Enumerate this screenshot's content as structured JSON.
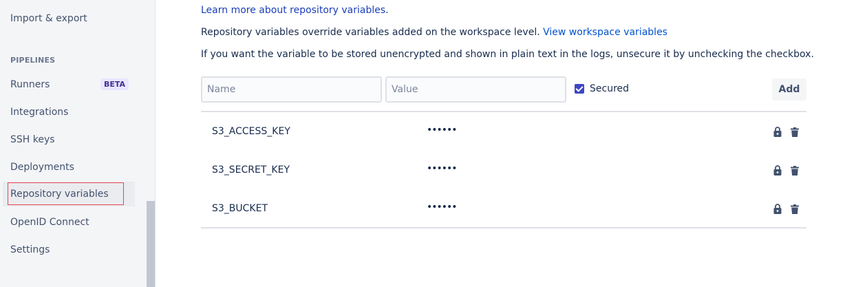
{
  "sidebar": {
    "top_item": "Import & export",
    "section_title": "PIPELINES",
    "items": [
      {
        "label": "Runners",
        "badge": "BETA"
      },
      {
        "label": "Integrations"
      },
      {
        "label": "SSH keys"
      },
      {
        "label": "Deployments"
      },
      {
        "label": "Repository variables",
        "selected": true
      },
      {
        "label": "OpenID Connect"
      },
      {
        "label": "Settings"
      }
    ]
  },
  "main": {
    "learn_more_link": "Learn more about repository variables",
    "learn_more_suffix": ".",
    "override_text": "Repository variables override variables added on the workspace level. ",
    "workspace_link": "View workspace variables",
    "unencrypted_text": "If you want the variable to be stored unencrypted and shown in plain text in the logs, unsecure it by unchecking the checkbox.",
    "form": {
      "name_placeholder": "Name",
      "value_placeholder": "Value",
      "secured_label": "Secured",
      "secured_checked": true,
      "add_label": "Add"
    },
    "variables": [
      {
        "name": "S3_ACCESS_KEY",
        "value": "••••••"
      },
      {
        "name": "S3_SECRET_KEY",
        "value": "••••••"
      },
      {
        "name": "S3_BUCKET",
        "value": "••••••"
      }
    ]
  },
  "colors": {
    "accent": "#3e46c4",
    "link": "#0052cc",
    "selection_outline": "#e5474f"
  }
}
